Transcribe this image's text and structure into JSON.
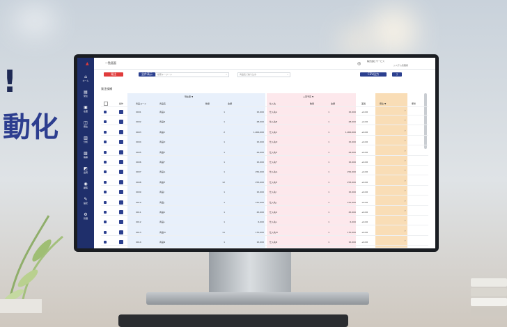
{
  "headline": {
    "exclaim": "!",
    "text": "動化"
  },
  "app": {
    "page_title": "一覧画面",
    "header_right_text": "株式会社 サービス",
    "header_right_sub": "システム管理者",
    "toolbar": {
      "red_button": "発注",
      "blue_button": "全件表示",
      "search1_placeholder": "検索キーワード",
      "search2_placeholder": "商品名で絞り込み",
      "action_button": "CSV出力",
      "help_button": "?"
    },
    "section_title": "発注候補",
    "sidebar": [
      {
        "icon": "home-icon",
        "glyph": "⌂",
        "label": "ホーム"
      },
      {
        "icon": "list-icon",
        "glyph": "▤",
        "label": "受注"
      },
      {
        "icon": "box-icon",
        "glyph": "▣",
        "label": "在庫"
      },
      {
        "icon": "cart-icon",
        "glyph": "◫",
        "label": "発注"
      },
      {
        "icon": "chart-icon",
        "glyph": "▥",
        "label": "分析"
      },
      {
        "icon": "doc-icon",
        "glyph": "▧",
        "label": "帳票"
      },
      {
        "icon": "truck-icon",
        "glyph": "◩",
        "label": "出荷"
      },
      {
        "icon": "user-icon",
        "glyph": "◉",
        "label": "顧客"
      },
      {
        "icon": "wrench-icon",
        "glyph": "✎",
        "label": "設定"
      },
      {
        "icon": "gear-icon",
        "glyph": "⚙",
        "label": "管理"
      }
    ],
    "table": {
      "group_headers": [
        "現在庫 ▼",
        "入荷予定 ▼"
      ],
      "headers": [
        "チェック",
        "操作",
        "商品コード",
        "商品名",
        "数量",
        "金額",
        "仕入先",
        "数量",
        "金額",
        "差異",
        "発注 ▼",
        "備考"
      ],
      "rows": [
        [
          "",
          "",
          "0001",
          "商品A",
          "1",
          "15,000",
          "仕入先A",
          "1",
          "15,000",
          "+0.00",
          "",
          ""
        ],
        [
          "",
          "",
          "0002",
          "商品B",
          "1",
          "28,000",
          "仕入先B",
          "1",
          "28,000",
          "+0.00",
          "",
          ""
        ],
        [
          "",
          "",
          "0003",
          "商品C",
          "2",
          "1,000,000",
          "仕入先C",
          "1",
          "1,000,000",
          "+0.00",
          "",
          ""
        ],
        [
          "",
          "",
          "0004",
          "商品D",
          "1",
          "15,000",
          "仕入先D",
          "1",
          "15,000",
          "+0.00",
          "",
          ""
        ],
        [
          "",
          "",
          "0005",
          "商品E",
          "1",
          "24,000",
          "仕入先E",
          "1",
          "24,000",
          "+0.00",
          "",
          ""
        ],
        [
          "",
          "",
          "0006",
          "商品F",
          "1",
          "15,000",
          "仕入先F",
          "1",
          "15,000",
          "+0.00",
          "",
          ""
        ],
        [
          "",
          "",
          "0007",
          "商品G",
          "1",
          "252,000",
          "仕入先G",
          "1",
          "252,000",
          "+0.00",
          "",
          ""
        ],
        [
          "",
          "",
          "0008",
          "商品H",
          "12",
          "253,000",
          "仕入先H",
          "1",
          "253,000",
          "+0.00",
          "",
          ""
        ],
        [
          "",
          "",
          "0009",
          "商品I",
          "1",
          "15,000",
          "仕入先I",
          "1",
          "15,000",
          "+0.00",
          "",
          ""
        ],
        [
          "",
          "",
          "0010",
          "商品J",
          "1",
          "151,000",
          "仕入先J",
          "1",
          "151,000",
          "+0.00",
          "",
          ""
        ],
        [
          "",
          "",
          "0011",
          "商品K",
          "1",
          "25,000",
          "仕入先K",
          "1",
          "25,000",
          "+0.00",
          "",
          ""
        ],
        [
          "",
          "",
          "0012",
          "商品L",
          "1",
          "6,000",
          "仕入先L",
          "1",
          "6,000",
          "+0.00",
          "",
          ""
        ],
        [
          "",
          "",
          "0013",
          "商品M",
          "11",
          "170,000",
          "仕入先M",
          "1",
          "170,000",
          "+0.00",
          "",
          ""
        ],
        [
          "",
          "",
          "0014",
          "商品N",
          "1",
          "15,000",
          "仕入先N",
          "1",
          "15,000",
          "+0.00",
          "",
          ""
        ]
      ]
    }
  },
  "colors": {
    "sidebar": "#1f2f6b",
    "accent_red": "#e03b3b",
    "accent_blue": "#2b3f8f",
    "stock_zone": "#e8f0fb",
    "incoming_zone": "#fde8ec",
    "order_zone": "#f9ddb6"
  }
}
